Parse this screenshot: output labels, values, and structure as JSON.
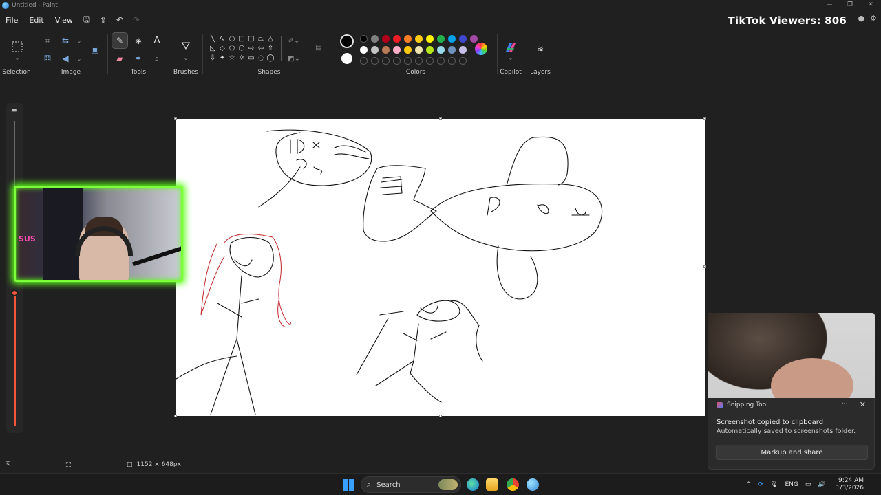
{
  "window": {
    "title": "Untitled - Paint",
    "controls": [
      "—",
      "❐",
      "✕"
    ]
  },
  "menu": {
    "items": [
      "File",
      "Edit",
      "View"
    ]
  },
  "overlay": {
    "tiktok_viewers": "TikTok Viewers: 806"
  },
  "ribbon": {
    "groups": {
      "selection": "Selection",
      "image": "Image",
      "tools": "Tools",
      "brushes": "Brushes",
      "shapes": "Shapes",
      "colors": "Colors",
      "copilot": "Copilot",
      "layers": "Layers"
    },
    "palette_row1": [
      "#000000",
      "#7f7f7f",
      "#b0001b",
      "#ee1c24",
      "#ff7f27",
      "#ffca18",
      "#fff200",
      "#22b14c",
      "#00a2e8",
      "#3f48cc",
      "#a349a4"
    ],
    "palette_row2": [
      "#ffffff",
      "#c3c3c3",
      "#b97a57",
      "#ffaec9",
      "#ffc90e",
      "#efe4b0",
      "#b5e61d",
      "#99d9ea",
      "#7092be",
      "#c8bfe7"
    ]
  },
  "status": {
    "canvas_size": "1152 × 648px"
  },
  "toast": {
    "app": "Snipping Tool",
    "title": "Screenshot copied to clipboard",
    "subtitle": "Automatically saved to screenshots folder.",
    "button": "Markup and share"
  },
  "taskbar": {
    "search_label": "Search",
    "language": "ENG",
    "time": "9:24 AM",
    "date": "1/3/2026"
  },
  "webcam": {
    "brand_text": "SUS"
  }
}
